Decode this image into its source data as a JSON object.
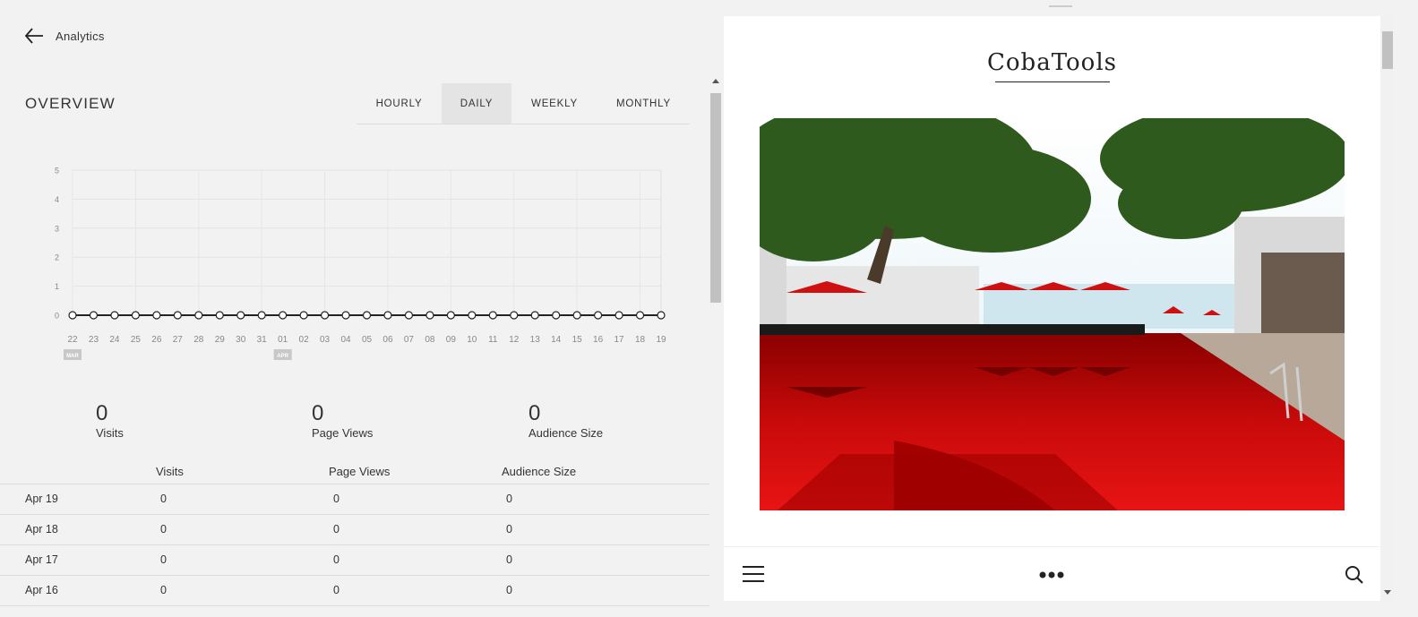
{
  "nav": {
    "back_label": "Analytics"
  },
  "overview": {
    "title": "OVERVIEW",
    "tabs": [
      "HOURLY",
      "DAILY",
      "WEEKLY",
      "MONTHLY"
    ],
    "active_tab": "DAILY"
  },
  "chart_data": {
    "type": "line",
    "x": [
      "22",
      "23",
      "24",
      "25",
      "26",
      "27",
      "28",
      "29",
      "30",
      "31",
      "01",
      "02",
      "03",
      "04",
      "05",
      "06",
      "07",
      "08",
      "09",
      "10",
      "11",
      "12",
      "13",
      "14",
      "15",
      "16",
      "17",
      "18",
      "19"
    ],
    "month_markers": [
      {
        "label": "MAR",
        "at": "22"
      },
      {
        "label": "APR",
        "at": "01"
      }
    ],
    "series": [
      {
        "values": [
          0,
          0,
          0,
          0,
          0,
          0,
          0,
          0,
          0,
          0,
          0,
          0,
          0,
          0,
          0,
          0,
          0,
          0,
          0,
          0,
          0,
          0,
          0,
          0,
          0,
          0,
          0,
          0,
          0
        ]
      }
    ],
    "y_ticks": [
      "0",
      "1",
      "2",
      "3",
      "4",
      "5"
    ],
    "ylim": [
      0,
      5
    ],
    "grid": true
  },
  "stats": [
    {
      "value": "0",
      "label": "Visits"
    },
    {
      "value": "0",
      "label": "Page Views"
    },
    {
      "value": "0",
      "label": "Audience Size"
    }
  ],
  "table": {
    "headers": [
      "Visits",
      "Page Views",
      "Audience Size"
    ],
    "rows": [
      {
        "date": "Apr 19",
        "visits": "0",
        "pageviews": "0",
        "audience": "0"
      },
      {
        "date": "Apr 18",
        "visits": "0",
        "pageviews": "0",
        "audience": "0"
      },
      {
        "date": "Apr 17",
        "visits": "0",
        "pageviews": "0",
        "audience": "0"
      },
      {
        "date": "Apr 16",
        "visits": "0",
        "pageviews": "0",
        "audience": "0"
      }
    ]
  },
  "preview": {
    "site_title": "CobaTools",
    "hero_description": "red-pool-resort-image",
    "icons": [
      "menu-icon",
      "more-icon",
      "search-icon"
    ]
  },
  "colors": {
    "background": "#f2f2f2",
    "active_tab": "#e4e4e4",
    "line": "#222222",
    "pool_red": "#c80a0a"
  }
}
